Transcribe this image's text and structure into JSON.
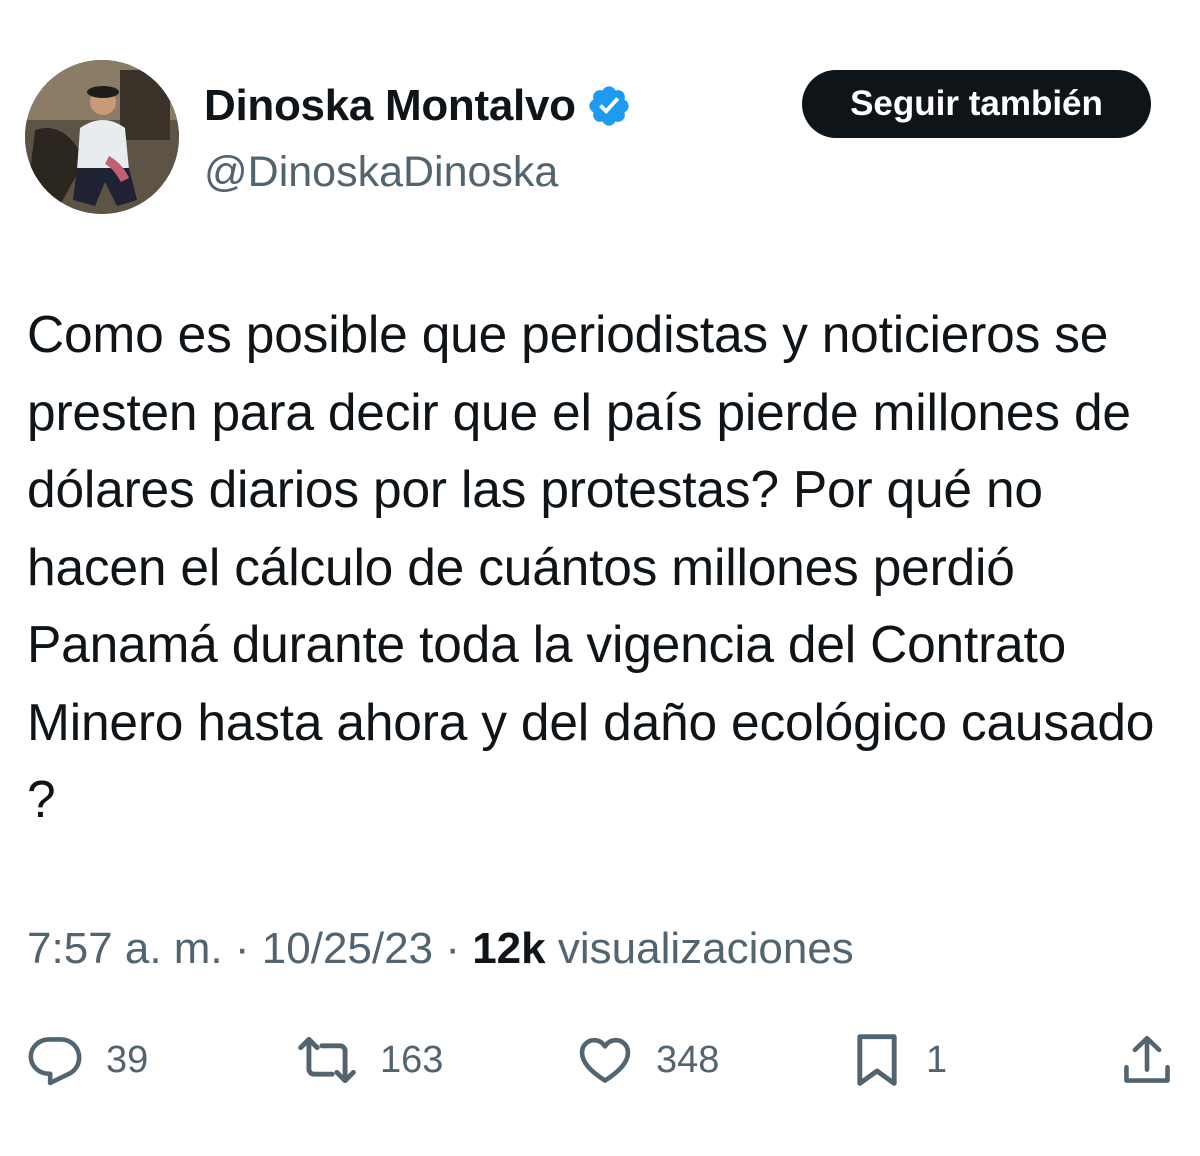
{
  "author": {
    "display_name": "Dinoska Montalvo",
    "handle": "@DinoskaDinoska",
    "verified": true,
    "verified_color": "#1d9bf0"
  },
  "follow_button": {
    "label": "Seguir también"
  },
  "tweet": {
    "text": "Como es posible que periodistas y noticieros se presten para decir que el país pierde millones de dólares diarios por las protestas? Por qué no hacen el cálculo de cuántos millones perdió Panamá durante toda la vigencia del Contrato Minero hasta ahora y del daño ecológico causado ?",
    "time": "7:57 a. m.",
    "date": "10/25/23",
    "views": "12k",
    "views_label": "visualizaciones",
    "separator": "·"
  },
  "actions": {
    "reply": {
      "icon": "reply-icon",
      "count": "39"
    },
    "retweet": {
      "icon": "retweet-icon",
      "count": "163"
    },
    "like": {
      "icon": "heart-icon",
      "count": "348"
    },
    "bookmark": {
      "icon": "bookmark-icon",
      "count": "1"
    },
    "share": {
      "icon": "share-icon"
    }
  },
  "colors": {
    "text": "#0f1419",
    "secondary": "#536471",
    "button_bg": "#0f1419"
  }
}
